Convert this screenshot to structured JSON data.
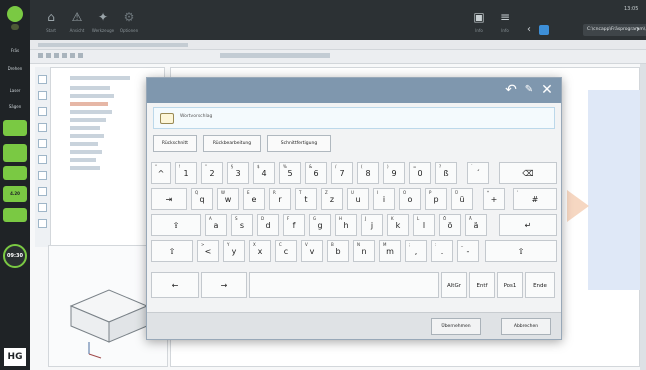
{
  "topbar": {
    "icon_labels": [
      "Start",
      "Ansicht",
      "Werkzeuge",
      "Optionen"
    ],
    "right_labels": [
      "Info",
      "Info"
    ],
    "path_text": "C:\\cncapp\\Fräsprogramm\\...",
    "time": "13:05"
  },
  "sidebar": {
    "items": [
      "Fräs",
      "Drehen",
      "Laser",
      "Sägen"
    ],
    "badges": [
      "4.20",
      "09:30"
    ],
    "logo": "HG"
  },
  "keyboard": {
    "controls": [
      "↶",
      "✎",
      "✕"
    ],
    "input_text": "Wortvorschlag",
    "suggestions": [
      "Rückschnitt",
      "Rückbearbeitung",
      "Schnittfertigung"
    ],
    "rows": [
      [
        {
          "main": "^",
          "sup": "°"
        },
        {
          "main": "1",
          "sup": "!"
        },
        {
          "main": "2",
          "sup": "\""
        },
        {
          "main": "3",
          "sup": "§"
        },
        {
          "main": "4",
          "sup": "$"
        },
        {
          "main": "5",
          "sup": "%"
        },
        {
          "main": "6",
          "sup": "&"
        },
        {
          "main": "7",
          "sup": "/"
        },
        {
          "main": "8",
          "sup": "("
        },
        {
          "main": "9",
          "sup": ")"
        },
        {
          "main": "0",
          "sup": "="
        },
        {
          "main": "ß",
          "sup": "?"
        },
        {
          "main": "´",
          "sup": "`"
        },
        {
          "main": "⌫",
          "sup": ""
        }
      ],
      [
        {
          "main": "⇥",
          "sup": ""
        },
        {
          "main": "q",
          "sup": "Q"
        },
        {
          "main": "w",
          "sup": "W"
        },
        {
          "main": "e",
          "sup": "E"
        },
        {
          "main": "r",
          "sup": "R"
        },
        {
          "main": "t",
          "sup": "T"
        },
        {
          "main": "z",
          "sup": "Z"
        },
        {
          "main": "u",
          "sup": "U"
        },
        {
          "main": "i",
          "sup": "I"
        },
        {
          "main": "o",
          "sup": "O"
        },
        {
          "main": "p",
          "sup": "P"
        },
        {
          "main": "ü",
          "sup": "Ü"
        },
        {
          "main": "+",
          "sup": "*"
        },
        {
          "main": "#",
          "sup": "'"
        }
      ],
      [
        {
          "main": "⇪",
          "sup": ""
        },
        {
          "main": "a",
          "sup": "A"
        },
        {
          "main": "s",
          "sup": "S"
        },
        {
          "main": "d",
          "sup": "D"
        },
        {
          "main": "f",
          "sup": "F"
        },
        {
          "main": "g",
          "sup": "G"
        },
        {
          "main": "h",
          "sup": "H"
        },
        {
          "main": "j",
          "sup": "J"
        },
        {
          "main": "k",
          "sup": "K"
        },
        {
          "main": "l",
          "sup": "L"
        },
        {
          "main": "ö",
          "sup": "Ö"
        },
        {
          "main": "ä",
          "sup": "Ä"
        },
        {
          "main": "↵",
          "sup": ""
        }
      ],
      [
        {
          "main": "⇧",
          "sup": ""
        },
        {
          "main": "<",
          "sup": ">"
        },
        {
          "main": "y",
          "sup": "Y"
        },
        {
          "main": "x",
          "sup": "X"
        },
        {
          "main": "c",
          "sup": "C"
        },
        {
          "main": "v",
          "sup": "V"
        },
        {
          "main": "b",
          "sup": "B"
        },
        {
          "main": "n",
          "sup": "N"
        },
        {
          "main": "m",
          "sup": "M"
        },
        {
          "main": ",",
          "sup": ";"
        },
        {
          "main": ".",
          "sup": ":"
        },
        {
          "main": "-",
          "sup": "_"
        },
        {
          "main": "⇧",
          "sup": ""
        }
      ],
      [
        {
          "main": "←",
          "sup": ""
        },
        {
          "main": "→",
          "sup": ""
        },
        {
          "main": "",
          "sup": ""
        },
        {
          "main": "AltGr",
          "sup": ""
        },
        {
          "main": "Entf",
          "sup": ""
        },
        {
          "main": "Pos1",
          "sup": ""
        },
        {
          "main": "Ende",
          "sup": ""
        }
      ]
    ],
    "bottom_buttons": [
      "Übernehmen",
      "Abbrechen"
    ]
  },
  "colors": {
    "title_bar": "#7f97ae",
    "sidebar_green": "#7ac943",
    "sidebar_dark": "#1f2326"
  }
}
